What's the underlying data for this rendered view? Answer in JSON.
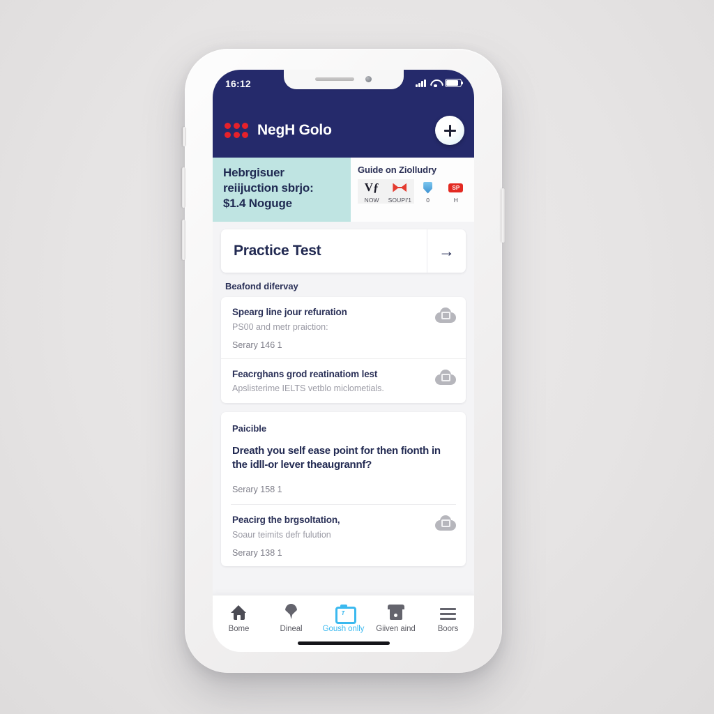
{
  "status_bar": {
    "time": "16:12",
    "signal_icon": "signal-bars-icon",
    "wifi_icon": "wifi-icon",
    "battery_icon": "battery-icon"
  },
  "header": {
    "logo_icon": "six-dots-logo-icon",
    "brand": "NegH Golo",
    "add_button_icon": "plus-icon",
    "brand_bg": "#252a6b",
    "logo_color": "#e6212a"
  },
  "promo": {
    "bg": "#bfe4e2",
    "lines": [
      "Hebrgisuer",
      "reiijuction sbrjo:",
      "$1.4 Noguge"
    ],
    "guide_title": "Guide on Ziolludry",
    "quick_actions": [
      {
        "glyph": "vs-icon",
        "label": "NOW"
      },
      {
        "glyph": "ribbon-icon",
        "label": "SOUPI'1"
      },
      {
        "glyph": "shield-icon",
        "label": "0"
      },
      {
        "glyph": "stamp-icon",
        "label": "H"
      }
    ]
  },
  "practice_card": {
    "title": "Practice Test",
    "arrow_icon": "arrow-right-icon"
  },
  "section": {
    "heading": "Beafond difervay"
  },
  "list_items": [
    {
      "title": "Spearg line jour refuration",
      "subtitle": "PS00 and metr praiction:",
      "meta": "Serary 146 1",
      "icon": "cloud-upload-icon"
    },
    {
      "title": "Feacrghans grod reatinatiom lest",
      "subtitle": "Apslisterime IELTS vetblo miclometials.",
      "meta": "",
      "icon": "cloud-upload-icon"
    }
  ],
  "block_card": {
    "kicker": "Paicible",
    "question": "Dreath you self ease point for then fionth in the idll-or lever theaugrannf?",
    "meta": "Serary 158 1",
    "footer_item": {
      "title": "Peacirg the brgsoltation,",
      "subtitle": "Soaur teimits defr fulution",
      "meta": "Serary 138 1",
      "icon": "cloud-upload-icon"
    }
  },
  "bottom_nav": {
    "active_color": "#3bb9ef",
    "items": [
      {
        "icon": "home-icon",
        "label": "Bome",
        "active": false
      },
      {
        "icon": "location-pin-icon",
        "label": "Dineal",
        "active": false
      },
      {
        "icon": "clipboard-icon",
        "label": "Goush onlly",
        "active": true
      },
      {
        "icon": "store-icon",
        "label": "Giiven aind",
        "active": false
      },
      {
        "icon": "menu-icon",
        "label": "Boors",
        "active": false
      }
    ]
  }
}
